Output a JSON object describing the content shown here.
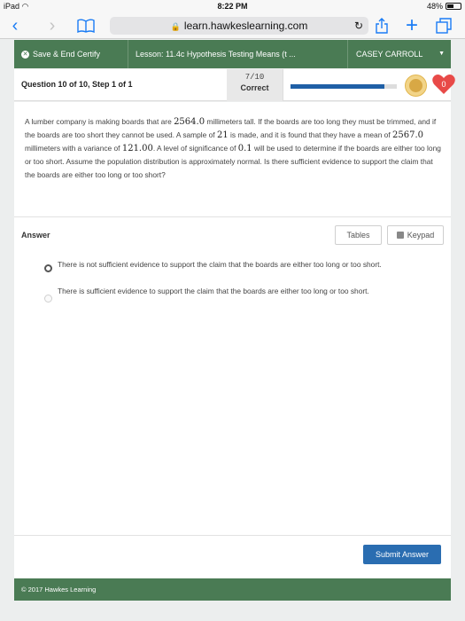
{
  "status_bar": {
    "device": "iPad",
    "time": "8:22 PM",
    "battery": "48%",
    "battery_level": 0.48
  },
  "browser": {
    "url": "learn.hawkeslearning.com"
  },
  "course_bar": {
    "save_end_label": "Save & End Certify",
    "lesson_label": "Lesson: 11.4c Hypothesis Testing Means (t ...",
    "user_name": "CASEY CARROLL"
  },
  "question_header": {
    "title": "Question 10 of 10, Step 1 of 1",
    "score_ratio": "7/10",
    "score_label": "Correct",
    "progress": 0.88,
    "hearts": "0"
  },
  "question": {
    "p1": "A lumber company is making boards that are ",
    "tall_value": "2564.0",
    "p2": " millimeters tall.  If the boards are too long they must be trimmed, and if the boards are too short they cannot be used.  A sample of ",
    "sample_size": "21",
    "p3": " is made, and it is found that they have a mean of ",
    "mean_value": "2567.0",
    "p4": " millimeters with a variance of ",
    "variance_value": "121.00",
    "p5": ".  A level of significance of ",
    "alpha_value": "0.1",
    "p6": " will be used to determine if the boards are either too long or too short.  Assume the population distribution is approximately normal.  Is there sufficient evidence to support the claim that the boards are either too long or too short?"
  },
  "answer": {
    "label": "Answer",
    "tables_label": "Tables",
    "keypad_label": "Keypad",
    "options": [
      {
        "text": "There is not sufficient evidence to support the claim that the boards are either too long or too short.",
        "selected": true
      },
      {
        "text": "There is sufficient evidence to support the claim that the boards are either too long or too short.",
        "selected": false
      }
    ],
    "submit_label": "Submit Answer"
  },
  "footer": {
    "text": "© 2017 Hawkes Learning"
  }
}
